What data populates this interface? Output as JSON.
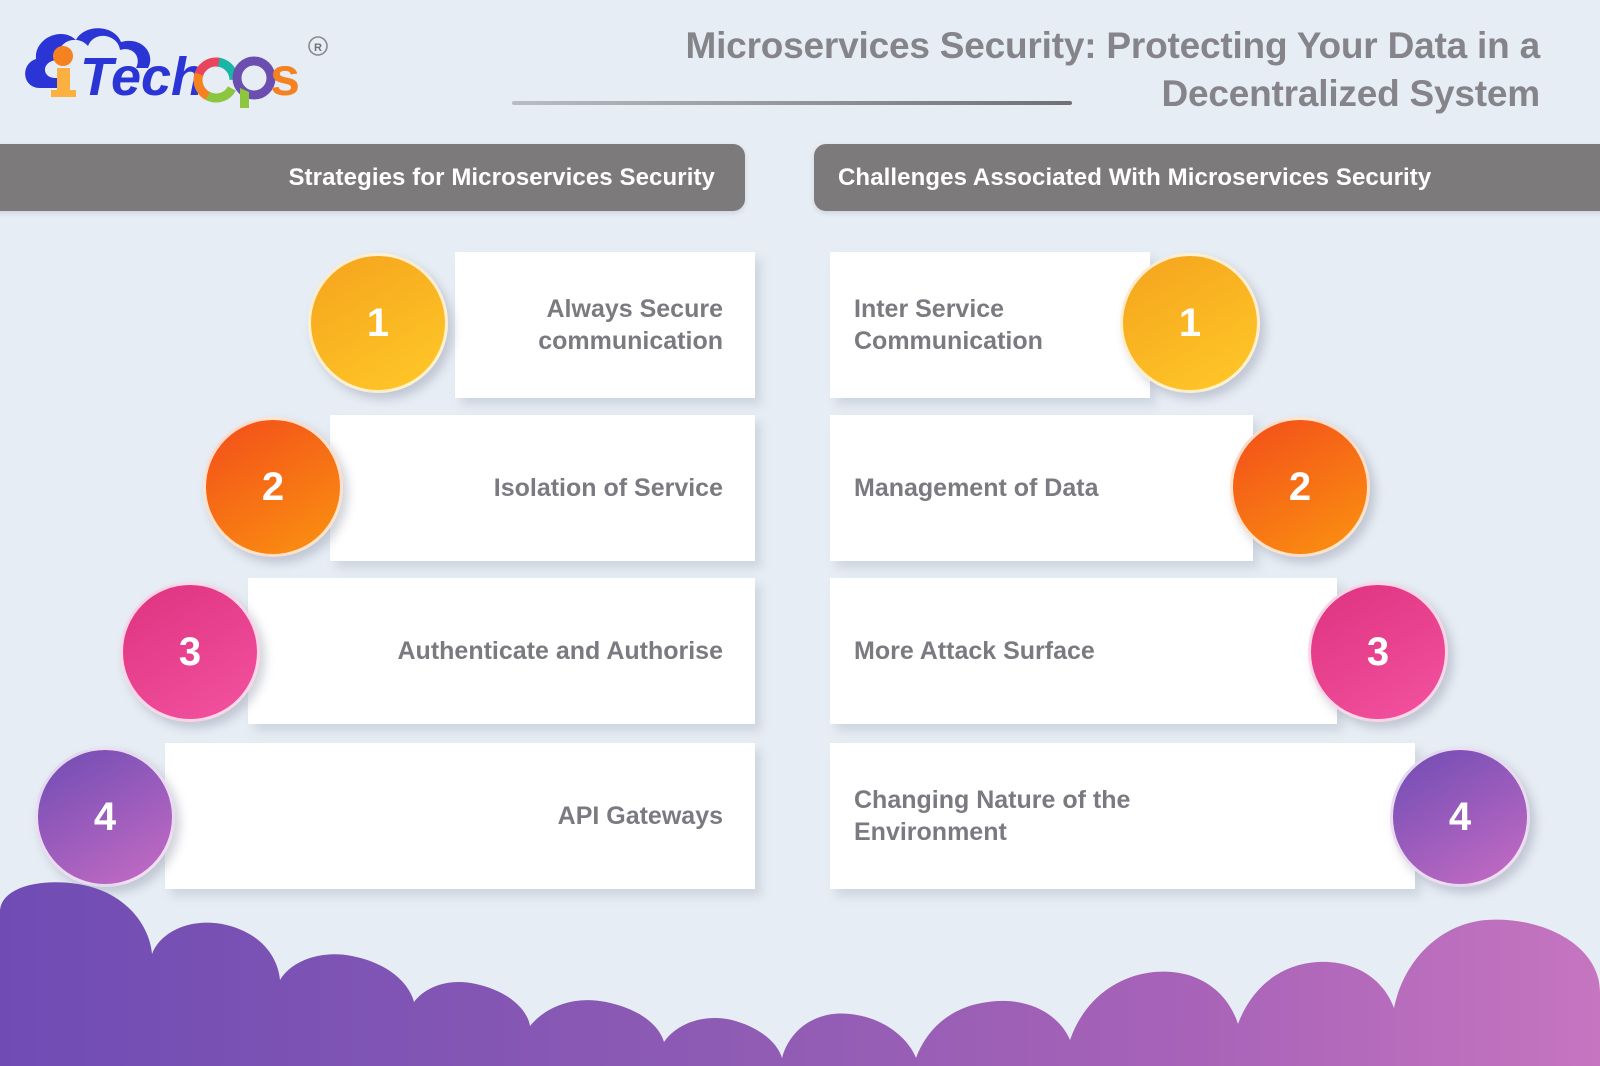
{
  "brand": {
    "name": "iTechOps",
    "trademark": "®",
    "colors": {
      "blue": "#2b35d6",
      "orange": "#f58220",
      "green": "#8cc63f",
      "teal": "#18b6a5",
      "pink": "#e8455c",
      "purple": "#6a4fb0"
    }
  },
  "header": {
    "title_line1": "Microservices Security: Protecting Your Data in a",
    "title_line2": "Decentralized System",
    "title_color": "#85848a"
  },
  "columns": {
    "left": {
      "heading": "Strategies for Microservices Security",
      "items": [
        {
          "num": "1",
          "label": "Always Secure\ncommunication",
          "color_from": "#f5a31d",
          "color_to": "#ffc928"
        },
        {
          "num": "2",
          "label": "Isolation of Service",
          "color_from": "#f24d1a",
          "color_to": "#fb9310"
        },
        {
          "num": "3",
          "label": "Authenticate and Authorise",
          "color_from": "#de3380",
          "color_to": "#f3529f"
        },
        {
          "num": "4",
          "label": "API Gateways",
          "color_from": "#6f4cb4",
          "color_to": "#c66cc4"
        }
      ]
    },
    "right": {
      "heading": "Challenges Associated With Microservices Security",
      "items": [
        {
          "num": "1",
          "label": "Inter Service\nCommunication",
          "color_from": "#f5a31d",
          "color_to": "#ffc928"
        },
        {
          "num": "2",
          "label": "Management of Data",
          "color_from": "#f24d1a",
          "color_to": "#fb9310"
        },
        {
          "num": "3",
          "label": "More Attack Surface",
          "color_from": "#de3380",
          "color_to": "#f3529f"
        },
        {
          "num": "4",
          "label": "Changing Nature of the\nEnvironment",
          "color_from": "#6f4cb4",
          "color_to": "#c66cc4"
        }
      ]
    }
  },
  "theme": {
    "background": "#e7edf4",
    "bar_color": "#7d7a7c",
    "card_background": "#ffffff",
    "text_gray": "#7b7a80",
    "cloud_from": "#6f4cb4",
    "cloud_to": "#c675c0"
  }
}
